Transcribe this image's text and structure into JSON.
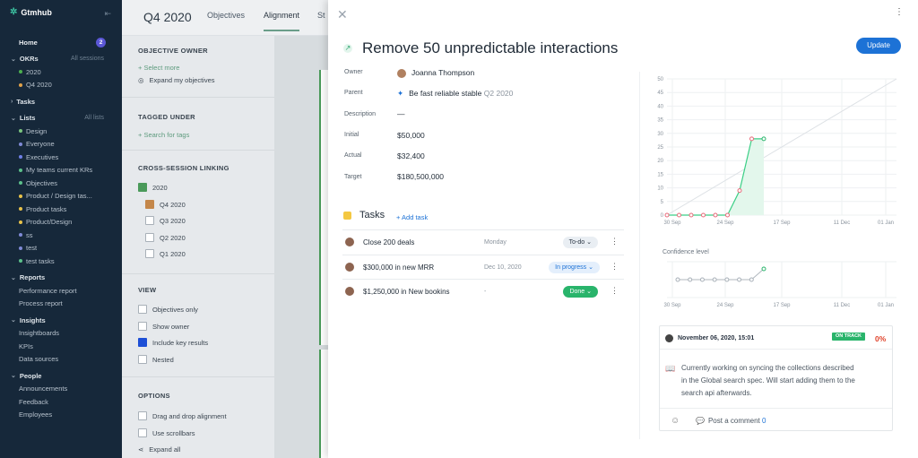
{
  "app": {
    "name": "Gtmhub"
  },
  "sidebar": {
    "home": "Home",
    "home_badge": "2",
    "okrs": "OKRs",
    "okrs_right": "All sessions",
    "okr_items": [
      {
        "label": "2020",
        "color": "#4caf50"
      },
      {
        "label": "Q4 2020",
        "color": "#e0a24a"
      }
    ],
    "tasks": "Tasks",
    "lists": "Lists",
    "lists_right": "All lists",
    "list_items": [
      {
        "label": "Design",
        "color": "#7bc47f"
      },
      {
        "label": "Everyone",
        "color": "#7f8ad6"
      },
      {
        "label": "Executives",
        "color": "#6f7fe6"
      },
      {
        "label": "My teams current KRs",
        "color": "#5cc08a"
      },
      {
        "label": "Objectives",
        "color": "#5cc08a"
      },
      {
        "label": "Product / Design tas...",
        "color": "#e8c24a"
      },
      {
        "label": "Product tasks",
        "color": "#e8c24a"
      },
      {
        "label": "Product/Design",
        "color": "#e8c24a"
      },
      {
        "label": "ss",
        "color": "#7f8ad6"
      },
      {
        "label": "test",
        "color": "#7f8ad6"
      },
      {
        "label": "test tasks",
        "color": "#5cc08a"
      }
    ],
    "reports": "Reports",
    "report_items": [
      "Performance report",
      "Process report"
    ],
    "insights": "Insights",
    "insight_items": [
      "Insightboards",
      "KPIs",
      "Data sources"
    ],
    "people": "People",
    "people_items": [
      "Announcements",
      "Feedback",
      "Employees"
    ]
  },
  "header": {
    "session": "Q4 2020",
    "tabs": [
      "Objectives",
      "Alignment",
      "St"
    ]
  },
  "filters": {
    "objective_owner": "OBJECTIVE OWNER",
    "select_more": "+ Select more",
    "expand_my": "Expand my objectives",
    "tagged_under": "TAGGED UNDER",
    "search_tags": "+ Search for tags",
    "cross_session": "CROSS-SESSION LINKING",
    "sessions": [
      {
        "label": "2020",
        "color": "#4a9a5a"
      },
      {
        "label": "Q4 2020",
        "color": "#c4874a"
      },
      {
        "label": "Q3 2020",
        "color": ""
      },
      {
        "label": "Q2 2020",
        "color": ""
      },
      {
        "label": "Q1 2020",
        "color": ""
      }
    ],
    "view": "VIEW",
    "view_items": [
      {
        "label": "Objectives only",
        "checked": false
      },
      {
        "label": "Show owner",
        "checked": false
      },
      {
        "label": "Include key results",
        "checked": true
      },
      {
        "label": "Nested",
        "checked": false
      }
    ],
    "options": "OPTIONS",
    "option_items": [
      "Drag and drop alignment",
      "Use scrollbars"
    ],
    "expand_all": "Expand all"
  },
  "objective": {
    "title": "Remove 50 unpredictable interactions",
    "update": "Update",
    "owner_label": "Owner",
    "owner": "Joanna Thompson",
    "parent_label": "Parent",
    "parent": "Be fast reliable stable",
    "parent_session": "Q2 2020",
    "description_label": "Description",
    "description": "—",
    "initial_label": "Initial",
    "initial": "$50,000",
    "actual_label": "Actual",
    "actual": "$32,400",
    "target_label": "Target",
    "target": "$180,500,000"
  },
  "tasks": {
    "title": "Tasks",
    "add": "+ Add task",
    "rows": [
      {
        "name": "Close 200 deals",
        "date": "Monday",
        "status": "To-do",
        "status_color": "#e9eef3",
        "status_text": "#2a3442"
      },
      {
        "name": "$300,000 in new MRR",
        "date": "Dec 10, 2020",
        "status": "In progress",
        "status_color": "#e4effc",
        "status_text": "#1d72d6"
      },
      {
        "name": "$1,250,000 in New bookins",
        "date": "-",
        "status": "Done",
        "status_color": "#29b46b",
        "status_text": "#ffffff"
      }
    ]
  },
  "chart_data": [
    {
      "type": "line",
      "title": "",
      "ylim": [
        0,
        50
      ],
      "yticks": [
        "0",
        "5",
        "10",
        "15",
        "20",
        "25",
        "30",
        "35",
        "40",
        "45",
        "50"
      ],
      "xticks": [
        "30 Sep",
        "24 Sep",
        "17 Sep",
        "11 Dec",
        "01 Jan"
      ],
      "series": [
        {
          "values": [
            0,
            0,
            0,
            0,
            0,
            0,
            9,
            28,
            28
          ]
        }
      ],
      "ideal_line": [
        0,
        50
      ]
    },
    {
      "type": "line",
      "title": "Confidence level",
      "xticks": [
        "30 Sep",
        "24 Sep",
        "17 Sep",
        "11 Dec",
        "01 Jan"
      ],
      "series": [
        {
          "values": [
            0.5,
            0.5,
            0.5,
            0.5,
            0.5,
            0.5,
            0.5,
            0.8
          ]
        }
      ]
    }
  ],
  "comment": {
    "date": "November 06, 2020, 15:01",
    "status": "ON TRACK",
    "percent": "0%",
    "body": "Currently working on syncing the collections described in the Global search spec. Will start adding them to the search api afterwards.",
    "post": "Post a comment",
    "post_count": "0"
  }
}
